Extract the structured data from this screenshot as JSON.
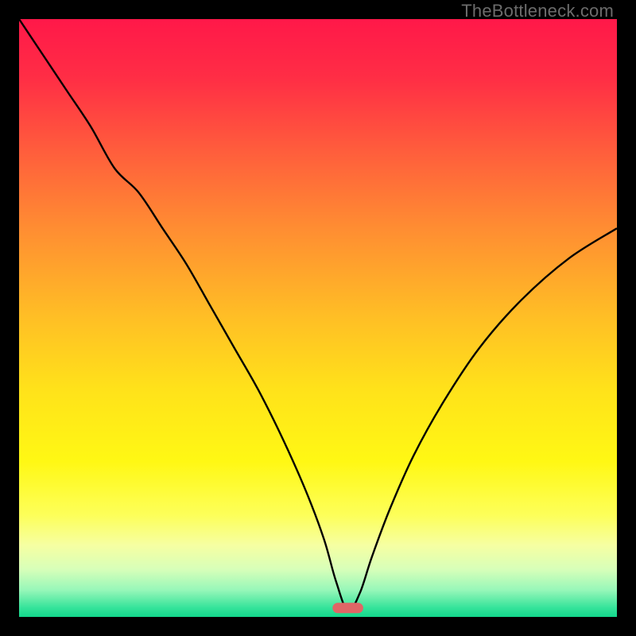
{
  "watermark": "TheBottleneck.com",
  "colors": {
    "frame": "#000000",
    "curve": "#000000",
    "marker_fill": "#e06666",
    "marker_stroke": "#e06666",
    "gradient_stops": [
      {
        "offset": 0.0,
        "color": "#ff1849"
      },
      {
        "offset": 0.1,
        "color": "#ff2e45"
      },
      {
        "offset": 0.22,
        "color": "#ff5d3c"
      },
      {
        "offset": 0.35,
        "color": "#ff8d32"
      },
      {
        "offset": 0.5,
        "color": "#ffbf25"
      },
      {
        "offset": 0.62,
        "color": "#ffe21a"
      },
      {
        "offset": 0.74,
        "color": "#fff814"
      },
      {
        "offset": 0.83,
        "color": "#fdff5a"
      },
      {
        "offset": 0.88,
        "color": "#f6ffa2"
      },
      {
        "offset": 0.92,
        "color": "#d8ffb9"
      },
      {
        "offset": 0.955,
        "color": "#97f7b9"
      },
      {
        "offset": 0.985,
        "color": "#34e39a"
      },
      {
        "offset": 1.0,
        "color": "#12d78b"
      }
    ]
  },
  "chart_data": {
    "type": "line",
    "title": "",
    "xlabel": "",
    "ylabel": "",
    "xlim": [
      0,
      100
    ],
    "ylim": [
      0,
      100
    ],
    "grid": false,
    "legend": false,
    "marker": {
      "x": 55,
      "width": 5,
      "y": 1.5
    },
    "series": [
      {
        "name": "bottleneck-curve",
        "x": [
          0,
          4,
          8,
          12,
          16,
          20,
          24,
          28,
          32,
          36,
          40,
          44,
          48,
          51,
          53,
          55,
          57,
          59,
          62,
          66,
          71,
          77,
          84,
          92,
          100
        ],
        "y": [
          100,
          94,
          88,
          82,
          75,
          71,
          65,
          59,
          52,
          45,
          38,
          30,
          21,
          13,
          6,
          1,
          4,
          10,
          18,
          27,
          36,
          45,
          53,
          60,
          65
        ]
      }
    ]
  }
}
